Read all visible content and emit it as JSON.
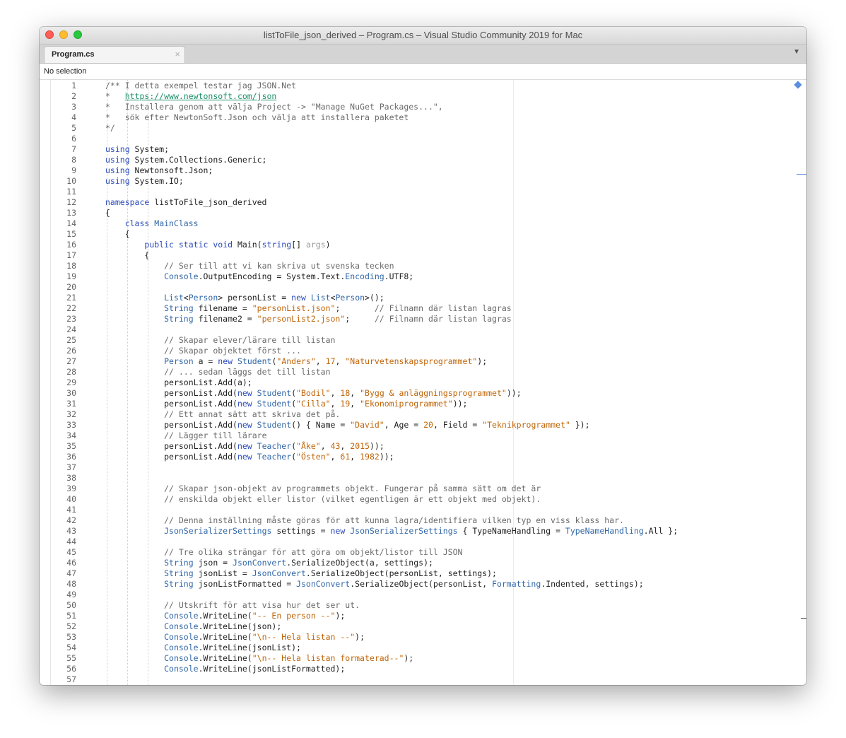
{
  "window": {
    "title": "listToFile_json_derived – Program.cs – Visual Studio Community 2019 for Mac"
  },
  "tabs": [
    {
      "label": "Program.cs",
      "close": "×"
    }
  ],
  "path_bar": {
    "text": "No selection"
  },
  "icons": {
    "tab_overflow": "▼"
  },
  "code_lines": [
    {
      "n": "1",
      "indent": 0,
      "tokens": [
        {
          "c": "cm",
          "t": "/** I detta exempel testar jag JSON.Net"
        }
      ]
    },
    {
      "n": "2",
      "indent": 0,
      "tokens": [
        {
          "c": "cm",
          "t": "*   "
        },
        {
          "c": "lk",
          "t": "https://www.newtonsoft.com/json"
        }
      ]
    },
    {
      "n": "3",
      "indent": 0,
      "tokens": [
        {
          "c": "cm",
          "t": "*   Installera genom att välja Project -> \"Manage NuGet Packages...\","
        }
      ]
    },
    {
      "n": "4",
      "indent": 0,
      "tokens": [
        {
          "c": "cm",
          "t": "*   sök efter NewtonSoft.Json och välja att installera paketet"
        }
      ]
    },
    {
      "n": "5",
      "indent": 0,
      "tokens": [
        {
          "c": "cm",
          "t": "*/"
        }
      ]
    },
    {
      "n": "6",
      "indent": 0,
      "tokens": []
    },
    {
      "n": "7",
      "indent": 0,
      "tokens": [
        {
          "c": "kw",
          "t": "using"
        },
        {
          "c": "",
          "t": " System;"
        }
      ]
    },
    {
      "n": "8",
      "indent": 0,
      "tokens": [
        {
          "c": "kw",
          "t": "using"
        },
        {
          "c": "",
          "t": " System.Collections.Generic;"
        }
      ]
    },
    {
      "n": "9",
      "indent": 0,
      "tokens": [
        {
          "c": "kw",
          "t": "using"
        },
        {
          "c": "",
          "t": " Newtonsoft.Json;"
        }
      ]
    },
    {
      "n": "10",
      "indent": 0,
      "tokens": [
        {
          "c": "kw",
          "t": "using"
        },
        {
          "c": "",
          "t": " System.IO;"
        }
      ]
    },
    {
      "n": "11",
      "indent": 0,
      "tokens": []
    },
    {
      "n": "12",
      "indent": 0,
      "tokens": [
        {
          "c": "kw",
          "t": "namespace"
        },
        {
          "c": "",
          "t": " listToFile_json_derived"
        }
      ]
    },
    {
      "n": "13",
      "indent": 0,
      "tokens": [
        {
          "c": "",
          "t": "{"
        }
      ]
    },
    {
      "n": "14",
      "indent": 1,
      "tokens": [
        {
          "c": "kw",
          "t": "class"
        },
        {
          "c": "",
          "t": " "
        },
        {
          "c": "ty",
          "t": "MainClass"
        }
      ]
    },
    {
      "n": "15",
      "indent": 1,
      "tokens": [
        {
          "c": "",
          "t": "{"
        }
      ]
    },
    {
      "n": "16",
      "indent": 2,
      "tokens": [
        {
          "c": "kw",
          "t": "public"
        },
        {
          "c": "",
          "t": " "
        },
        {
          "c": "kw",
          "t": "static"
        },
        {
          "c": "",
          "t": " "
        },
        {
          "c": "kw",
          "t": "void"
        },
        {
          "c": "",
          "t": " Main("
        },
        {
          "c": "kw",
          "t": "string"
        },
        {
          "c": "",
          "t": "[] "
        },
        {
          "c": "unused",
          "t": "args"
        },
        {
          "c": "",
          "t": ")"
        }
      ]
    },
    {
      "n": "17",
      "indent": 2,
      "tokens": [
        {
          "c": "",
          "t": "{"
        }
      ]
    },
    {
      "n": "18",
      "indent": 3,
      "tokens": [
        {
          "c": "cm",
          "t": "// Ser till att vi kan skriva ut svenska tecken"
        }
      ]
    },
    {
      "n": "19",
      "indent": 3,
      "tokens": [
        {
          "c": "ty",
          "t": "Console"
        },
        {
          "c": "",
          "t": ".OutputEncoding = System.Text."
        },
        {
          "c": "ty",
          "t": "Encoding"
        },
        {
          "c": "",
          "t": ".UTF8;"
        }
      ]
    },
    {
      "n": "20",
      "indent": 3,
      "tokens": []
    },
    {
      "n": "21",
      "indent": 3,
      "tokens": [
        {
          "c": "ty",
          "t": "List"
        },
        {
          "c": "",
          "t": "<"
        },
        {
          "c": "ty",
          "t": "Person"
        },
        {
          "c": "",
          "t": "> personList = "
        },
        {
          "c": "kw",
          "t": "new"
        },
        {
          "c": "",
          "t": " "
        },
        {
          "c": "ty",
          "t": "List"
        },
        {
          "c": "",
          "t": "<"
        },
        {
          "c": "ty",
          "t": "Person"
        },
        {
          "c": "",
          "t": ">();"
        }
      ]
    },
    {
      "n": "22",
      "indent": 3,
      "tokens": [
        {
          "c": "ty",
          "t": "String"
        },
        {
          "c": "",
          "t": " filename = "
        },
        {
          "c": "st",
          "t": "\"personList.json\""
        },
        {
          "c": "",
          "t": ";       "
        },
        {
          "c": "cm",
          "t": "// Filnamn där listan lagras"
        }
      ]
    },
    {
      "n": "23",
      "indent": 3,
      "tokens": [
        {
          "c": "ty",
          "t": "String"
        },
        {
          "c": "",
          "t": " filename2 = "
        },
        {
          "c": "st",
          "t": "\"personList2.json\""
        },
        {
          "c": "",
          "t": ";     "
        },
        {
          "c": "cm",
          "t": "// Filnamn där listan lagras"
        }
      ]
    },
    {
      "n": "24",
      "indent": 3,
      "tokens": []
    },
    {
      "n": "25",
      "indent": 3,
      "tokens": [
        {
          "c": "cm",
          "t": "// Skapar elever/lärare till listan"
        }
      ]
    },
    {
      "n": "26",
      "indent": 3,
      "tokens": [
        {
          "c": "cm",
          "t": "// Skapar objektet först ..."
        }
      ]
    },
    {
      "n": "27",
      "indent": 3,
      "tokens": [
        {
          "c": "ty",
          "t": "Person"
        },
        {
          "c": "",
          "t": " a = "
        },
        {
          "c": "kw",
          "t": "new"
        },
        {
          "c": "",
          "t": " "
        },
        {
          "c": "ty",
          "t": "Student"
        },
        {
          "c": "",
          "t": "("
        },
        {
          "c": "st",
          "t": "\"Anders\""
        },
        {
          "c": "",
          "t": ", "
        },
        {
          "c": "nu",
          "t": "17"
        },
        {
          "c": "",
          "t": ", "
        },
        {
          "c": "st",
          "t": "\"Naturvetenskapsprogrammet\""
        },
        {
          "c": "",
          "t": ");"
        }
      ]
    },
    {
      "n": "28",
      "indent": 3,
      "tokens": [
        {
          "c": "cm",
          "t": "// ... sedan läggs det till listan"
        }
      ]
    },
    {
      "n": "29",
      "indent": 3,
      "tokens": [
        {
          "c": "",
          "t": "personList.Add(a);"
        }
      ]
    },
    {
      "n": "30",
      "indent": 3,
      "tokens": [
        {
          "c": "",
          "t": "personList.Add("
        },
        {
          "c": "kw",
          "t": "new"
        },
        {
          "c": "",
          "t": " "
        },
        {
          "c": "ty",
          "t": "Student"
        },
        {
          "c": "",
          "t": "("
        },
        {
          "c": "st",
          "t": "\"Bodil\""
        },
        {
          "c": "",
          "t": ", "
        },
        {
          "c": "nu",
          "t": "18"
        },
        {
          "c": "",
          "t": ", "
        },
        {
          "c": "st",
          "t": "\"Bygg & anläggningsprogrammet\""
        },
        {
          "c": "",
          "t": "));"
        }
      ]
    },
    {
      "n": "31",
      "indent": 3,
      "tokens": [
        {
          "c": "",
          "t": "personList.Add("
        },
        {
          "c": "kw",
          "t": "new"
        },
        {
          "c": "",
          "t": " "
        },
        {
          "c": "ty",
          "t": "Student"
        },
        {
          "c": "",
          "t": "("
        },
        {
          "c": "st",
          "t": "\"Cilla\""
        },
        {
          "c": "",
          "t": ", "
        },
        {
          "c": "nu",
          "t": "19"
        },
        {
          "c": "",
          "t": ", "
        },
        {
          "c": "st",
          "t": "\"Ekonomiprogrammet\""
        },
        {
          "c": "",
          "t": "));"
        }
      ]
    },
    {
      "n": "32",
      "indent": 3,
      "tokens": [
        {
          "c": "cm",
          "t": "// Ett annat sätt att skriva det på."
        }
      ]
    },
    {
      "n": "33",
      "indent": 3,
      "tokens": [
        {
          "c": "",
          "t": "personList.Add("
        },
        {
          "c": "kw",
          "t": "new"
        },
        {
          "c": "",
          "t": " "
        },
        {
          "c": "ty",
          "t": "Student"
        },
        {
          "c": "",
          "t": "() { Name = "
        },
        {
          "c": "st",
          "t": "\"David\""
        },
        {
          "c": "",
          "t": ", Age = "
        },
        {
          "c": "nu",
          "t": "20"
        },
        {
          "c": "",
          "t": ", Field = "
        },
        {
          "c": "st",
          "t": "\"Teknikprogrammet\""
        },
        {
          "c": "",
          "t": " });"
        }
      ]
    },
    {
      "n": "34",
      "indent": 3,
      "tokens": [
        {
          "c": "cm",
          "t": "// Lägger till lärare"
        }
      ]
    },
    {
      "n": "35",
      "indent": 3,
      "tokens": [
        {
          "c": "",
          "t": "personList.Add("
        },
        {
          "c": "kw",
          "t": "new"
        },
        {
          "c": "",
          "t": " "
        },
        {
          "c": "ty",
          "t": "Teacher"
        },
        {
          "c": "",
          "t": "("
        },
        {
          "c": "st",
          "t": "\"Åke\""
        },
        {
          "c": "",
          "t": ", "
        },
        {
          "c": "nu",
          "t": "43"
        },
        {
          "c": "",
          "t": ", "
        },
        {
          "c": "nu",
          "t": "2015"
        },
        {
          "c": "",
          "t": "));"
        }
      ]
    },
    {
      "n": "36",
      "indent": 3,
      "tokens": [
        {
          "c": "",
          "t": "personList.Add("
        },
        {
          "c": "kw",
          "t": "new"
        },
        {
          "c": "",
          "t": " "
        },
        {
          "c": "ty",
          "t": "Teacher"
        },
        {
          "c": "",
          "t": "("
        },
        {
          "c": "st",
          "t": "\"Östen\""
        },
        {
          "c": "",
          "t": ", "
        },
        {
          "c": "nu",
          "t": "61"
        },
        {
          "c": "",
          "t": ", "
        },
        {
          "c": "nu",
          "t": "1982"
        },
        {
          "c": "",
          "t": "));"
        }
      ]
    },
    {
      "n": "37",
      "indent": 3,
      "tokens": []
    },
    {
      "n": "38",
      "indent": 3,
      "tokens": []
    },
    {
      "n": "39",
      "indent": 3,
      "tokens": [
        {
          "c": "cm",
          "t": "// Skapar json-objekt av programmets objekt. Fungerar på samma sätt om det är"
        }
      ]
    },
    {
      "n": "40",
      "indent": 3,
      "tokens": [
        {
          "c": "cm",
          "t": "// enskilda objekt eller listor (vilket egentligen är ett objekt med objekt)."
        }
      ]
    },
    {
      "n": "41",
      "indent": 3,
      "tokens": []
    },
    {
      "n": "42",
      "indent": 3,
      "tokens": [
        {
          "c": "cm",
          "t": "// Denna inställning måste göras för att kunna lagra/identifiera vilken typ en viss klass har."
        }
      ]
    },
    {
      "n": "43",
      "indent": 3,
      "tokens": [
        {
          "c": "ty",
          "t": "JsonSerializerSettings"
        },
        {
          "c": "",
          "t": " settings = "
        },
        {
          "c": "kw",
          "t": "new"
        },
        {
          "c": "",
          "t": " "
        },
        {
          "c": "ty",
          "t": "JsonSerializerSettings"
        },
        {
          "c": "",
          "t": " { TypeNameHandling = "
        },
        {
          "c": "ty",
          "t": "TypeNameHandling"
        },
        {
          "c": "",
          "t": ".All };"
        }
      ]
    },
    {
      "n": "44",
      "indent": 3,
      "tokens": []
    },
    {
      "n": "45",
      "indent": 3,
      "tokens": [
        {
          "c": "cm",
          "t": "// Tre olika strängar för att göra om objekt/listor till JSON"
        }
      ]
    },
    {
      "n": "46",
      "indent": 3,
      "tokens": [
        {
          "c": "ty",
          "t": "String"
        },
        {
          "c": "",
          "t": " json = "
        },
        {
          "c": "ty",
          "t": "JsonConvert"
        },
        {
          "c": "",
          "t": ".SerializeObject(a, settings);"
        }
      ]
    },
    {
      "n": "47",
      "indent": 3,
      "tokens": [
        {
          "c": "ty",
          "t": "String"
        },
        {
          "c": "",
          "t": " jsonList = "
        },
        {
          "c": "ty",
          "t": "JsonConvert"
        },
        {
          "c": "",
          "t": ".SerializeObject(personList, settings);"
        }
      ]
    },
    {
      "n": "48",
      "indent": 3,
      "tokens": [
        {
          "c": "ty",
          "t": "String"
        },
        {
          "c": "",
          "t": " jsonListFormatted = "
        },
        {
          "c": "ty",
          "t": "JsonConvert"
        },
        {
          "c": "",
          "t": ".SerializeObject(personList, "
        },
        {
          "c": "ty",
          "t": "Formatting"
        },
        {
          "c": "",
          "t": ".Indented, settings);"
        }
      ]
    },
    {
      "n": "49",
      "indent": 3,
      "tokens": []
    },
    {
      "n": "50",
      "indent": 3,
      "tokens": [
        {
          "c": "cm",
          "t": "// Utskrift för att visa hur det ser ut."
        }
      ]
    },
    {
      "n": "51",
      "indent": 3,
      "tokens": [
        {
          "c": "ty",
          "t": "Console"
        },
        {
          "c": "",
          "t": ".WriteLine("
        },
        {
          "c": "st",
          "t": "\"-- En person --\""
        },
        {
          "c": "",
          "t": ");"
        }
      ]
    },
    {
      "n": "52",
      "indent": 3,
      "tokens": [
        {
          "c": "ty",
          "t": "Console"
        },
        {
          "c": "",
          "t": ".WriteLine(json);"
        }
      ]
    },
    {
      "n": "53",
      "indent": 3,
      "tokens": [
        {
          "c": "ty",
          "t": "Console"
        },
        {
          "c": "",
          "t": ".WriteLine("
        },
        {
          "c": "st",
          "t": "\"\\n-- Hela listan --\""
        },
        {
          "c": "",
          "t": ");"
        }
      ]
    },
    {
      "n": "54",
      "indent": 3,
      "tokens": [
        {
          "c": "ty",
          "t": "Console"
        },
        {
          "c": "",
          "t": ".WriteLine(jsonList);"
        }
      ]
    },
    {
      "n": "55",
      "indent": 3,
      "tokens": [
        {
          "c": "ty",
          "t": "Console"
        },
        {
          "c": "",
          "t": ".WriteLine("
        },
        {
          "c": "st",
          "t": "\"\\n-- Hela listan formaterad--\""
        },
        {
          "c": "",
          "t": ");"
        }
      ]
    },
    {
      "n": "56",
      "indent": 3,
      "tokens": [
        {
          "c": "ty",
          "t": "Console"
        },
        {
          "c": "",
          "t": ".WriteLine(jsonListFormatted);"
        }
      ]
    },
    {
      "n": "57",
      "indent": 3,
      "tokens": []
    }
  ]
}
